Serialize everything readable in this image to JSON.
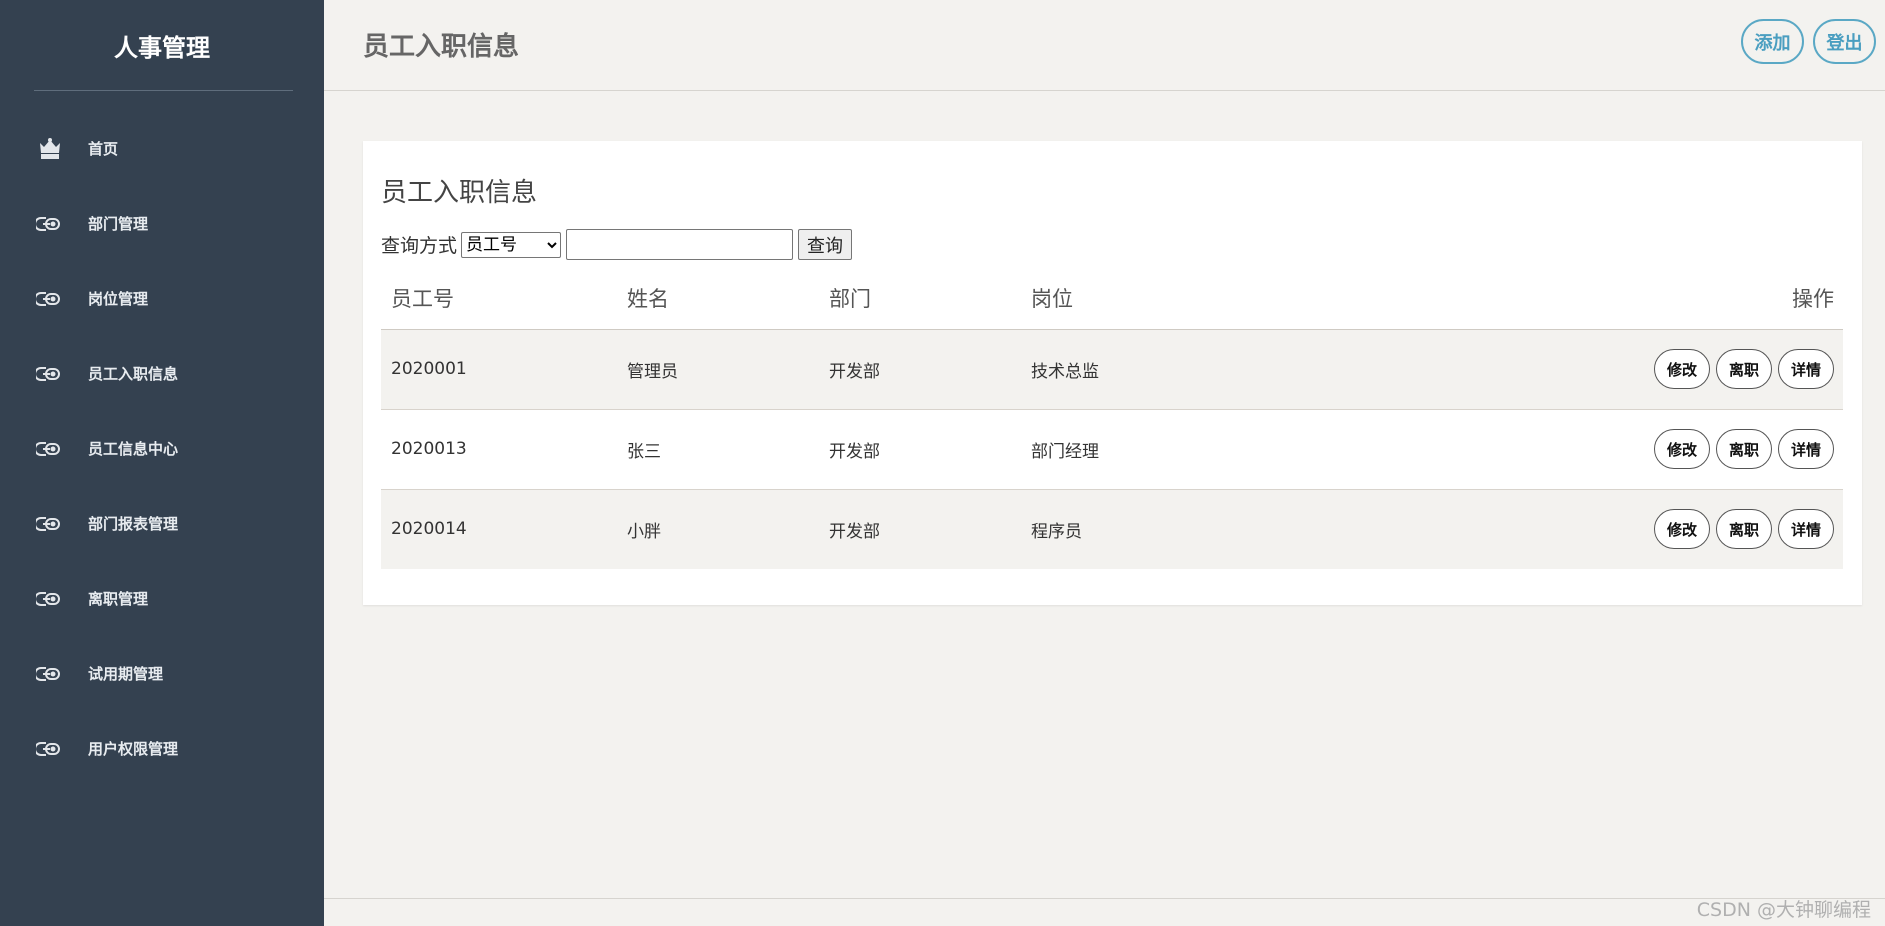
{
  "sidebar": {
    "brand": "人事管理",
    "items": [
      {
        "label": "首页",
        "icon": "home-icon"
      },
      {
        "label": "部门管理",
        "icon": "link-icon"
      },
      {
        "label": "岗位管理",
        "icon": "link-icon"
      },
      {
        "label": "员工入职信息",
        "icon": "link-icon"
      },
      {
        "label": "员工信息中心",
        "icon": "link-icon"
      },
      {
        "label": "部门报表管理",
        "icon": "link-icon"
      },
      {
        "label": "离职管理",
        "icon": "link-icon"
      },
      {
        "label": "试用期管理",
        "icon": "link-icon"
      },
      {
        "label": "用户权限管理",
        "icon": "link-icon"
      }
    ]
  },
  "header": {
    "title": "员工入职信息",
    "add_label": "添加",
    "logout_label": "登出"
  },
  "panel": {
    "title": "员工入职信息",
    "query_label": "查询方式",
    "query_select_value": "员工号",
    "query_input_value": "",
    "query_button": "查询"
  },
  "table": {
    "columns": [
      "员工号",
      "姓名",
      "部门",
      "岗位",
      "操作"
    ],
    "rows": [
      {
        "id": "2020001",
        "name": "管理员",
        "dept": "开发部",
        "position": "技术总监"
      },
      {
        "id": "2020013",
        "name": "张三",
        "dept": "开发部",
        "position": "部门经理"
      },
      {
        "id": "2020014",
        "name": "小胖",
        "dept": "开发部",
        "position": "程序员"
      }
    ],
    "actions": {
      "edit": "修改",
      "resign": "离职",
      "detail": "详情"
    }
  },
  "watermark": "CSDN @大钟聊编程",
  "colors": {
    "sidebar_bg": "#344150",
    "page_bg": "#f3f2ef",
    "accent": "#5aa8c5"
  }
}
